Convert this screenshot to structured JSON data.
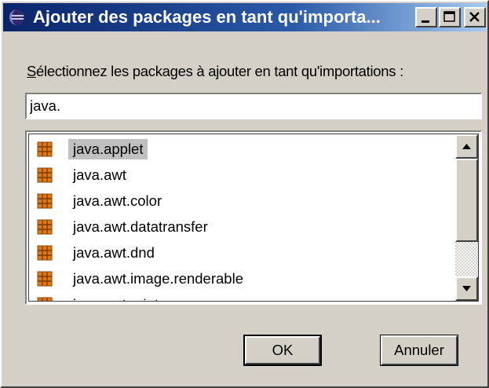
{
  "window": {
    "title": "Ajouter des packages en tant qu'importa...",
    "icon": "eclipse-icon",
    "controls": [
      "minimize-icon",
      "maximize-icon",
      "close-icon"
    ]
  },
  "prompt": {
    "mnemonic": "S",
    "rest": "électionnez les packages à ajouter en tant qu'importations :"
  },
  "filter": {
    "value": "java."
  },
  "packages": {
    "icon": "package-icon",
    "selected_index": 0,
    "items": [
      "java.applet",
      "java.awt",
      "java.awt.color",
      "java.awt.datatransfer",
      "java.awt.dnd",
      "java.awt.image.renderable",
      "java.awt.print"
    ]
  },
  "scrollbar": {
    "icons": [
      "scroll-up-icon",
      "scroll-down-icon"
    ]
  },
  "buttons": {
    "ok": "OK",
    "cancel": "Annuler"
  },
  "colors": {
    "titlebar_start": "#0a246a",
    "titlebar_end": "#a6caf0",
    "face": "#d4d0c8",
    "selection": "#c0c0c0",
    "package_icon": "#e07a10"
  }
}
